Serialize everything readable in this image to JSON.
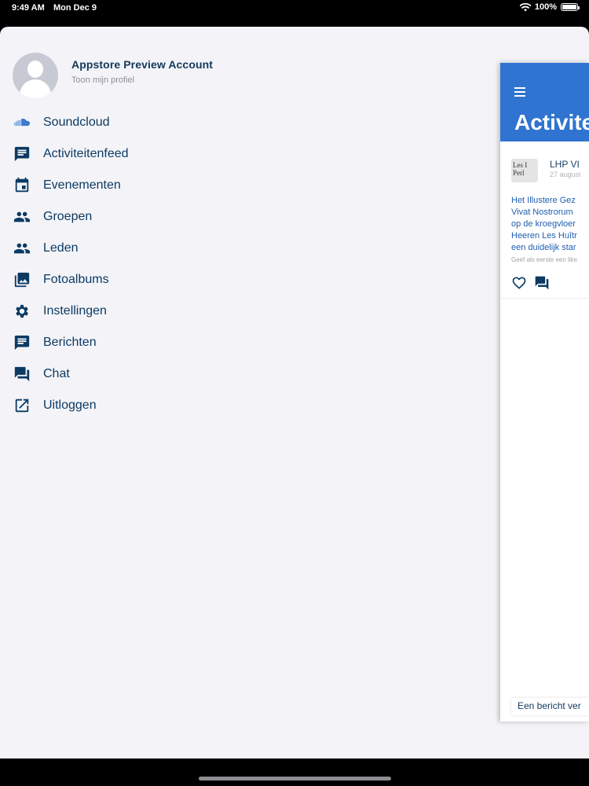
{
  "status_bar": {
    "time": "9:49 AM",
    "date": "Mon Dec 9",
    "battery": "100%",
    "battery_level": 1.0
  },
  "profile": {
    "name": "Appstore Preview Account",
    "link": "Toon mijn profiel"
  },
  "menu": {
    "items": [
      {
        "label": "Soundcloud",
        "icon": "soundcloud-icon"
      },
      {
        "label": "Activiteitenfeed",
        "icon": "chat-bubble-icon"
      },
      {
        "label": "Evenementen",
        "icon": "calendar-icon"
      },
      {
        "label": "Groepen",
        "icon": "people-icon"
      },
      {
        "label": "Leden",
        "icon": "people-icon"
      },
      {
        "label": "Fotoalbums",
        "icon": "photo-library-icon"
      },
      {
        "label": "Instellingen",
        "icon": "gear-icon"
      },
      {
        "label": "Berichten",
        "icon": "message-icon"
      },
      {
        "label": "Chat",
        "icon": "forum-icon"
      },
      {
        "label": "Uitloggen",
        "icon": "open-external-icon"
      }
    ]
  },
  "preview": {
    "title": "Activite",
    "post": {
      "avatar_text": "Les I\nPerl",
      "author": "LHP VI",
      "date": "27 august",
      "body": "Het Illustere Gez\nVivat Nostrorum\nop de kroegvloer\nHeeren Les Huîtr\neen duidelijk star",
      "likes": "Geef als eerste een like"
    },
    "bottom_input": "Een bericht ver"
  },
  "colors": {
    "accent": "#2f74d0",
    "text_dark": "#0c3a63",
    "sheet_bg": "#f4f4f8"
  }
}
